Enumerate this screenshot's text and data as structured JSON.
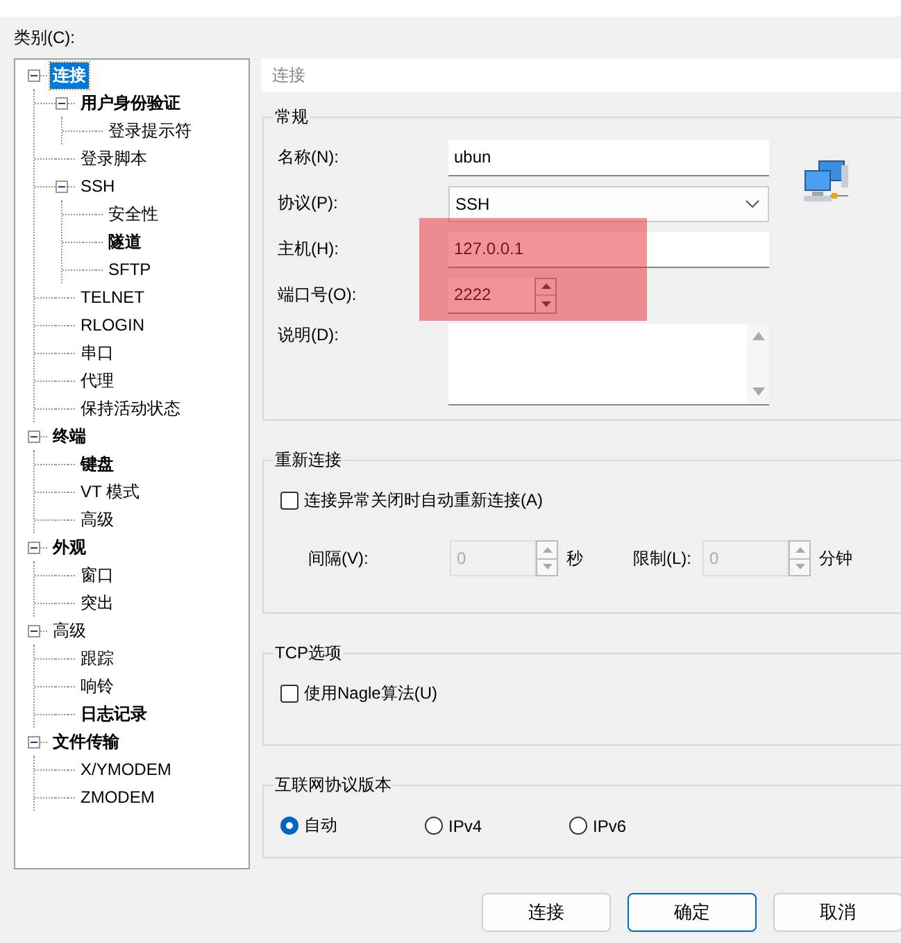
{
  "category_label": "类别(C):",
  "tree": [
    {
      "label": "连接",
      "selected": true,
      "bold": true,
      "expanded": true,
      "children": [
        {
          "label": "用户身份验证",
          "selected": false,
          "bold": true,
          "expanded": true,
          "children": [
            {
              "label": "登录提示符",
              "selected": false,
              "bold": false
            }
          ]
        },
        {
          "label": "登录脚本",
          "selected": false,
          "bold": false
        },
        {
          "label": "SSH",
          "selected": false,
          "bold": false,
          "expanded": true,
          "children": [
            {
              "label": "安全性",
              "selected": false,
              "bold": false
            },
            {
              "label": "隧道",
              "selected": false,
              "bold": true
            },
            {
              "label": "SFTP",
              "selected": false,
              "bold": false
            }
          ]
        },
        {
          "label": "TELNET",
          "selected": false,
          "bold": false
        },
        {
          "label": "RLOGIN",
          "selected": false,
          "bold": false
        },
        {
          "label": "串口",
          "selected": false,
          "bold": false
        },
        {
          "label": "代理",
          "selected": false,
          "bold": false
        },
        {
          "label": "保持活动状态",
          "selected": false,
          "bold": false
        }
      ]
    },
    {
      "label": "终端",
      "selected": false,
      "bold": true,
      "expanded": true,
      "children": [
        {
          "label": "键盘",
          "selected": false,
          "bold": true
        },
        {
          "label": "VT 模式",
          "selected": false,
          "bold": false
        },
        {
          "label": "高级",
          "selected": false,
          "bold": false
        }
      ]
    },
    {
      "label": "外观",
      "selected": false,
      "bold": true,
      "expanded": true,
      "children": [
        {
          "label": "窗口",
          "selected": false,
          "bold": false
        },
        {
          "label": "突出",
          "selected": false,
          "bold": false
        }
      ]
    },
    {
      "label": "高级",
      "selected": false,
      "bold": false,
      "expanded": true,
      "children": [
        {
          "label": "跟踪",
          "selected": false,
          "bold": false
        },
        {
          "label": "响铃",
          "selected": false,
          "bold": false
        },
        {
          "label": "日志记录",
          "selected": false,
          "bold": true
        }
      ]
    },
    {
      "label": "文件传输",
      "selected": false,
      "bold": true,
      "expanded": true,
      "children": [
        {
          "label": "X/YMODEM",
          "selected": false,
          "bold": false
        },
        {
          "label": "ZMODEM",
          "selected": false,
          "bold": false
        }
      ]
    }
  ],
  "page_title": "连接",
  "general": {
    "title": "常规",
    "fields": [
      {
        "kind": "text",
        "label": "名称(N):",
        "value": "ubun"
      },
      {
        "kind": "select",
        "label": "协议(P):",
        "value": "SSH"
      },
      {
        "kind": "text",
        "label": "主机(H):",
        "value": "127.0.0.1"
      },
      {
        "kind": "spinner",
        "label": "端口号(O):",
        "value": "2222"
      },
      {
        "kind": "textarea",
        "label": "说明(D):"
      }
    ]
  },
  "reconnect": {
    "title": "重新连接",
    "checkbox": {
      "label": "连接异常关闭时自动重新连接(A)",
      "checked": false
    },
    "spinners": [
      {
        "label": "间隔(V):",
        "value": "0",
        "unit": "秒",
        "disabled": true
      },
      {
        "label": "限制(L):",
        "value": "0",
        "unit": "分钟",
        "disabled": true
      }
    ]
  },
  "tcp": {
    "title": "TCP选项",
    "checkbox": {
      "label": "使用Nagle算法(U)",
      "checked": false
    }
  },
  "ip_version": {
    "title": "互联网协议版本",
    "options": [
      {
        "label": "自动",
        "selected": true
      },
      {
        "label": "IPv4",
        "selected": false
      },
      {
        "label": "IPv6",
        "selected": false
      }
    ]
  },
  "buttons": [
    {
      "label": "连接",
      "default": false
    },
    {
      "label": "确定",
      "default": true
    },
    {
      "label": "取消",
      "default": false
    }
  ]
}
